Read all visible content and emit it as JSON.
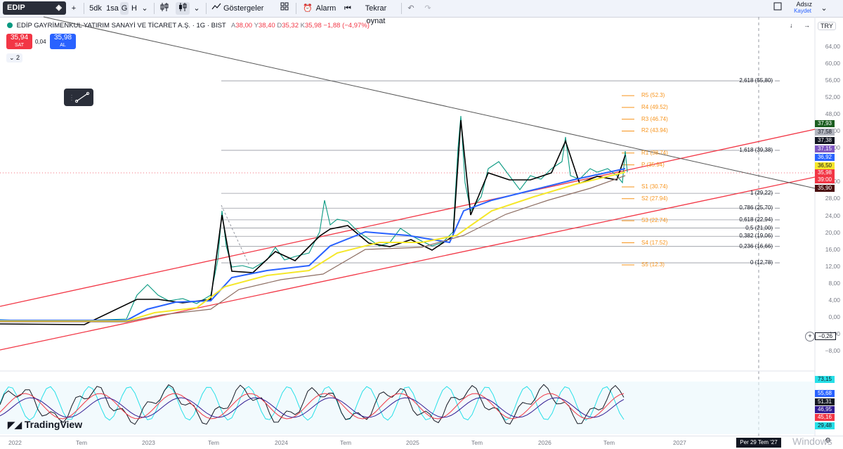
{
  "topbar": {
    "symbol": "EDIP",
    "add_symbol": "+",
    "intervals": [
      "5dk",
      "1sa",
      "G",
      "H"
    ],
    "indicators": "Göstergeler",
    "alarm": "Alarm",
    "replay": "Tekrar oynat",
    "user": "Adsız",
    "save": "Kaydet"
  },
  "legend": {
    "name": "EDİP GAYRİMENKUL YATIRIM SANAYİ VE TİCARET A.Ş. · 1G · BIST",
    "open_label": "A",
    "open": "38,00",
    "high_label": "Y",
    "high": "38,40",
    "low_label": "D",
    "low": "35,32",
    "close_label": "K",
    "close": "35,98",
    "change": "−1,88 (−4,97%)"
  },
  "trade": {
    "sell_price": "35,94",
    "sell_label": "SAT",
    "spread": "0,04",
    "buy_price": "35,98",
    "buy_label": "AL",
    "indicator_count": "2"
  },
  "chart_controls": {
    "currency": "TRY"
  },
  "chart_data": {
    "type": "line",
    "title": "EDİP GAYRİMENKUL YATIRIM SANAYİ VE TİCARET A.Ş. · 1G · BIST",
    "y_ticks": [
      "64,00",
      "60,00",
      "56,00",
      "52,00",
      "48,00",
      "44,00",
      "40,00",
      "32,00",
      "28,00",
      "24,00",
      "20,00",
      "16,00",
      "12,00",
      "8,00",
      "4,00",
      "0,00",
      "−4,00",
      "−8,00"
    ],
    "x_ticks": [
      "2022",
      "Tem",
      "2023",
      "Tem",
      "2024",
      "Tem",
      "2025",
      "Tem",
      "2026",
      "Tem",
      "2027"
    ],
    "x_cursor_label": "Per 29 Tem '27",
    "ylim": [
      -8,
      66
    ],
    "fibonacci": [
      {
        "label": "2,618 (55,80)",
        "value": 55.8
      },
      {
        "label": "1,618 (39,38)",
        "value": 39.38
      },
      {
        "label": "1 (29,22)",
        "value": 29.22
      },
      {
        "label": "0,786 (25,70)",
        "value": 25.7
      },
      {
        "label": "0,618 (22,94)",
        "value": 22.94
      },
      {
        "label": "0,5 (21,00)",
        "value": 21.0
      },
      {
        "label": "0,382 (19,06)",
        "value": 19.06
      },
      {
        "label": "0,236 (16,66)",
        "value": 16.66
      },
      {
        "label": "0 (12,78)",
        "value": 12.78
      }
    ],
    "pivots": [
      {
        "label": "R5 (52.3)",
        "value": 52.3
      },
      {
        "label": "R4 (49.52)",
        "value": 49.52
      },
      {
        "label": "R3 (46.74)",
        "value": 46.74
      },
      {
        "label": "R2 (43.94)",
        "value": 43.94
      },
      {
        "label": "R1 (38.74)",
        "value": 38.74
      },
      {
        "label": "P (35.94)",
        "value": 35.94
      },
      {
        "label": "S1 (30.74)",
        "value": 30.74
      },
      {
        "label": "S2 (27.94)",
        "value": 27.94
      },
      {
        "label": "S3 (22.74)",
        "value": 22.74
      },
      {
        "label": "S4 (17.52)",
        "value": 17.52
      },
      {
        "label": "S5 (12.3)",
        "value": 12.3
      }
    ],
    "price_tags": [
      {
        "text": "37,93",
        "bg": "#1b5e20",
        "fg": "#ffffff",
        "value": 37.93
      },
      {
        "text": "37,58",
        "bg": "#b2b5be",
        "fg": "#131722",
        "value": 37.58
      },
      {
        "text": "37,38",
        "bg": "#131722",
        "fg": "#ffffff",
        "value": 37.38
      },
      {
        "text": "37,15",
        "bg": "#7e57c2",
        "fg": "#ffffff",
        "value": 37.15
      },
      {
        "text": "36,92",
        "bg": "#2962ff",
        "fg": "#ffffff",
        "value": 36.92
      },
      {
        "text": "36,50",
        "bg": "#f5e72a",
        "fg": "#131722",
        "value": 36.5
      },
      {
        "text": "35,98",
        "bg": "#f23645",
        "fg": "#ffffff",
        "value": 35.98
      },
      {
        "text": "39:00",
        "bg": "#f23645",
        "fg": "#ffffff",
        "value": 35.3
      },
      {
        "text": "35,90",
        "bg": "#4a1010",
        "fg": "#ffffff",
        "value": 34.6
      }
    ],
    "zero_tag": "−0,26",
    "oscillator_tags": [
      {
        "text": "73,15",
        "bg": "#26e0e8",
        "fg": "#131722"
      },
      {
        "text": "55,68",
        "bg": "#2962ff",
        "fg": "#ffffff"
      },
      {
        "text": "51,31",
        "bg": "#131722",
        "fg": "#ffffff"
      },
      {
        "text": "46,95",
        "bg": "#311b92",
        "fg": "#ffffff"
      },
      {
        "text": "45,16",
        "bg": "#f23645",
        "fg": "#ffffff"
      },
      {
        "text": "29,48",
        "bg": "#26e0e8",
        "fg": "#131722"
      }
    ],
    "colors": {
      "price": "#131722",
      "ema_short": "#000000",
      "ema_mid": "#2962ff",
      "ema_long": "#f5e72a",
      "channel": "#f23645",
      "trendline": "#555555",
      "bull": "#089981",
      "bear": "#f23645"
    }
  },
  "branding": {
    "logo": "TradingView",
    "watermark": "Windows"
  }
}
